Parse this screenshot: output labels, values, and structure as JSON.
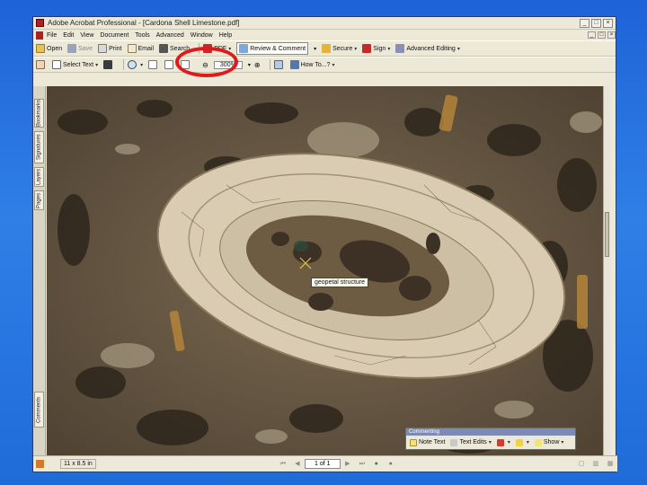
{
  "window": {
    "title": "Adobe Acrobat Professional - [Cardona Shell Limestone.pdf]"
  },
  "menu": [
    "File",
    "Edit",
    "View",
    "Document",
    "Tools",
    "Advanced",
    "Window",
    "Help"
  ],
  "toolbar1": {
    "open": "Open",
    "save": "Save",
    "print": "Print",
    "email": "Email",
    "search": "Search",
    "create_pdf": "PDF",
    "review": "Review & Comment",
    "secure": "Secure",
    "sign": "Sign",
    "advanced_editing": "Advanced Editing"
  },
  "toolbar2": {
    "select_text": "Select Text",
    "zoom_value": "300%",
    "how_to": "How To...?"
  },
  "nav_tabs": [
    "Bookmarks",
    "Signatures",
    "Layers",
    "Pages",
    "Comments"
  ],
  "tooltip": "geopetal structure",
  "commenting": {
    "title": "Commenting",
    "note_text": "Note Text",
    "text_edits": "Text Edits",
    "show": "Show"
  },
  "status": {
    "page_size": "11 x 8.5 in",
    "page_of": "1 of 1"
  },
  "colors": {
    "annotation": "#e01a1a",
    "background": "#1e63d8"
  }
}
